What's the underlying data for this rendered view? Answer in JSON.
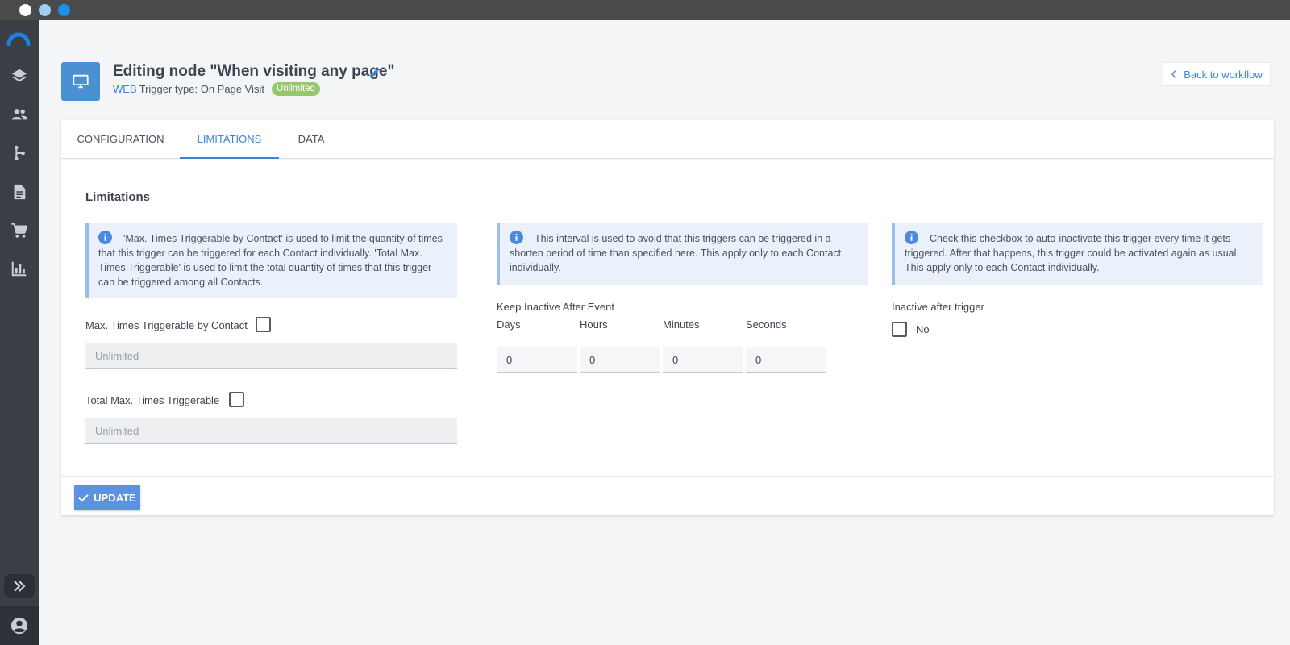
{
  "window": {
    "buttons": [
      "close",
      "minimize",
      "maximize"
    ]
  },
  "sidebar": {
    "logo": "app-logo",
    "items": [
      {
        "icon": "layers-icon"
      },
      {
        "icon": "people-icon"
      },
      {
        "icon": "workflow-icon"
      },
      {
        "icon": "document-icon"
      },
      {
        "icon": "cart-icon"
      },
      {
        "icon": "chart-icon"
      }
    ],
    "expand_icon": "double-chevron-right-icon",
    "user_icon": "account-icon"
  },
  "header": {
    "title": "Editing node \"When visiting any page\"",
    "channel": "WEB",
    "trigger_type": "Trigger type: On Page Visit",
    "badge": "Unlimited",
    "back_label": "Back to workflow"
  },
  "tabs": [
    {
      "label": "CONFIGURATION",
      "active": false
    },
    {
      "label": "LIMITATIONS",
      "active": true
    },
    {
      "label": "DATA",
      "active": false
    }
  ],
  "limitations": {
    "title": "Limitations",
    "info_1": "'Max. Times Triggerable by Contact' is used to limit the quantity of times that this trigger can be triggered for each Contact individually. 'Total Max. Times Triggerable' is used to limit the total quantity of times that this trigger can be triggered among all Contacts.",
    "info_2": "This interval is used to avoid that this triggers can be triggered in a shorten period of time than specified here. This apply only to each Contact individually.",
    "info_3": "Check this checkbox to auto-inactivate this trigger every time it gets triggered. After that happens, this trigger could be activated again as usual. This apply only to each Contact individually.",
    "max_by_contact_label": "Max. Times Triggerable by Contact",
    "max_by_contact_placeholder": "Unlimited",
    "total_max_label": "Total Max. Times Triggerable",
    "total_max_placeholder": "Unlimited",
    "keep_inactive_label": "Keep Inactive After Event",
    "days_label": "Days",
    "days_value": "0",
    "hours_label": "Hours",
    "hours_value": "0",
    "minutes_label": "Minutes",
    "minutes_value": "0",
    "seconds_label": "Seconds",
    "seconds_value": "0",
    "inactive_after_label": "Inactive after trigger",
    "inactive_after_value": "No"
  },
  "footer": {
    "update_label": "UPDATE"
  },
  "colors": {
    "accent": "#3d84d8",
    "badge_green": "#95c86a",
    "sidebar": "#3a3f46",
    "info_bg": "#eaf1fb"
  }
}
